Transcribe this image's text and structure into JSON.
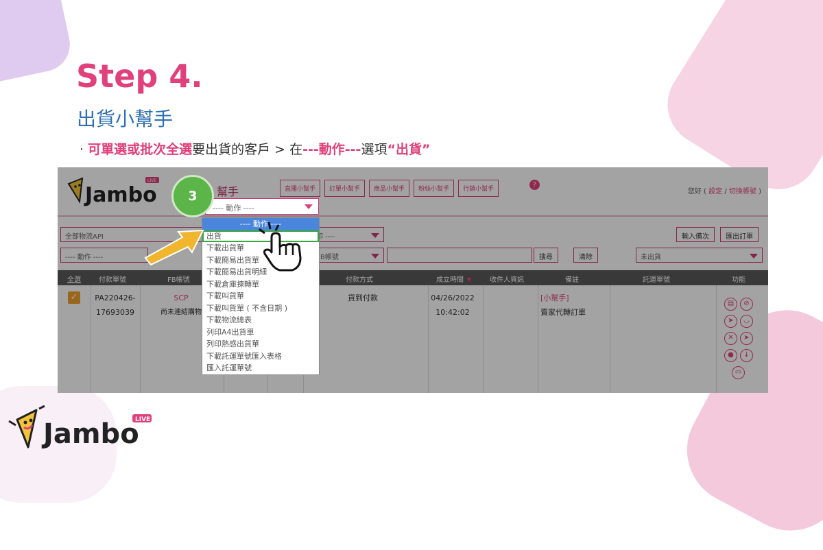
{
  "header": {
    "step": "Step 4.",
    "subtitle": "出貨小幫手",
    "instruction": {
      "bullet": "·",
      "p1": "可單選或批次全選",
      "p2": "要出貨的客戶 > 在",
      "p3": "---動作---",
      "p4": "選項",
      "p5": "“出貨”"
    }
  },
  "brand": {
    "name": "Jambo",
    "badge": "LIVE",
    "accent": "#e0407b",
    "blue": "#2f6fb1",
    "green": "#5bb548"
  },
  "app": {
    "page_heading": "幫手",
    "nav_buttons": [
      "直播小幫手",
      "訂單小幫手",
      "商品小幫手",
      "粉絲小幫手",
      "行銷小幫手"
    ],
    "help_icon": "?",
    "greeting_prefix": "您好 (",
    "greeting_settings": "設定",
    "greeting_sep": "/",
    "greeting_switch": "切換帳號",
    "greeting_suffix": ")",
    "filters": {
      "logistics": "全部物流API",
      "print": "印 ----",
      "action": "---- 動作 ----",
      "fb_account": "B帳號",
      "status": "未出貨",
      "import_btn": "輸入備次",
      "export_btn": "匯出訂單",
      "search_btn": "搜尋",
      "clear_btn": "清除"
    },
    "table": {
      "headers": [
        "全選",
        "付款單號",
        "FB帳號",
        "付款方式",
        "成立時間",
        "收件人資訊",
        "備註",
        "託運單號",
        "功能"
      ],
      "row": {
        "payment_no_1": "PA220426-",
        "payment_no_2": "17693039",
        "fb": "SCP",
        "fb_sub": "尚未連結購物",
        "payment_method": "貨到付款",
        "date": "04/26/2022",
        "time": "10:42:02",
        "remark_1": "[小幫手]",
        "remark_2": "賣家代轉訂單"
      }
    },
    "action_select": "---- 動作 ----",
    "dropdown_items": [
      "---- 動作 ----",
      "出貨",
      "下載出貨單",
      "下載簡易出貨單",
      "下載簡易出貨明細",
      "下載倉庫揀轉單",
      "下載叫貨單",
      "下載叫貨單 ( 不含日期 )",
      "下載物流總表",
      "列印A4出貨單",
      "列印熱感出貨單",
      "下載託運單號匯入表格",
      "匯入託運單號"
    ],
    "step_badge": "3",
    "icons": [
      "pointing-arrow-icon",
      "hand-click-icon",
      "clipboard-icon",
      "cancel-icon",
      "truck-icon",
      "basket-icon",
      "trash-icon",
      "delivery-icon",
      "chat-icon",
      "download-icon",
      "box-icon"
    ]
  }
}
